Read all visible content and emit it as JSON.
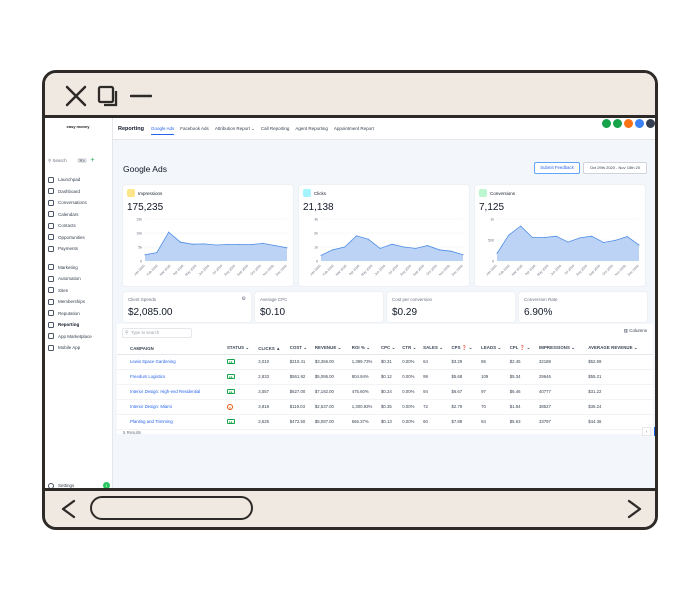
{
  "sidebar": {
    "logo": "easy money",
    "search_label": "Search",
    "search_shortcut": "⌘K",
    "items_group1": [
      {
        "label": "Launchpad",
        "icon": "rocket-icon"
      },
      {
        "label": "Dashboard",
        "icon": "dashboard-icon"
      },
      {
        "label": "Conversations",
        "icon": "chat-icon"
      },
      {
        "label": "Calendars",
        "icon": "calendar-icon"
      },
      {
        "label": "Contacts",
        "icon": "contacts-icon"
      },
      {
        "label": "Opportunities",
        "icon": "opportunities-icon"
      },
      {
        "label": "Payments",
        "icon": "payments-icon"
      }
    ],
    "items_group2": [
      {
        "label": "Marketing",
        "icon": "marketing-icon"
      },
      {
        "label": "Automation",
        "icon": "automation-icon"
      },
      {
        "label": "Sites",
        "icon": "sites-icon"
      },
      {
        "label": "Memberships",
        "icon": "memberships-icon"
      },
      {
        "label": "Reputation",
        "icon": "star-icon"
      },
      {
        "label": "Reporting",
        "icon": "reporting-icon",
        "active": true
      },
      {
        "label": "App Marketplace",
        "icon": "apps-icon"
      },
      {
        "label": "Mobile App",
        "icon": "mobile-icon"
      }
    ],
    "settings_label": "Settings",
    "settings_badge": "1"
  },
  "header": {
    "section": "Reporting",
    "tabs": [
      "Google Ads",
      "Facebook Ads",
      "Attribution Report ⌄",
      "Call Reporting",
      "Agent Reporting",
      "Appointment Report"
    ],
    "active_tab": "Google Ads",
    "icon_colors": [
      "#16a34a",
      "#16a34a",
      "#f97316",
      "#3b82f6",
      "#374151"
    ]
  },
  "page": {
    "title": "Google Ads",
    "feedback_button": "Submit Feedback",
    "date_range": "Oct 29th 2020 - Nov 15th 20"
  },
  "metrics": [
    {
      "label": "Impressions",
      "value": "175,235",
      "icon_color": "#fde68a",
      "y_ticks": [
        "15k",
        "10k",
        "5k",
        "0"
      ],
      "x_ticks": [
        "Jan 2020",
        "Feb 2020",
        "Mar 2020",
        "Apr 2020",
        "May 2020",
        "Jun 2020",
        "Jul 2020",
        "Aug 2020",
        "Sep 2020",
        "Oct 2020",
        "Nov 2020",
        "Dec 2020"
      ],
      "series": [
        2.2,
        3.0,
        10.3,
        6.7,
        6.0,
        6.1,
        5.7,
        5.9,
        5.9,
        5.9,
        6.3,
        5.5,
        4.7
      ]
    },
    {
      "label": "Clicks",
      "value": "21,138",
      "icon_color": "#a5f3fc",
      "y_ticks": [
        "3k",
        "2k",
        "1k",
        "0"
      ],
      "x_ticks": [
        "Jan 2020",
        "Feb 2020",
        "Mar 2020",
        "Apr 2020",
        "May 2020",
        "Jun 2020",
        "Jul 2020",
        "Aug 2020",
        "Sep 2020",
        "Oct 2020",
        "Nov 2020",
        "Dec 2020"
      ],
      "series": [
        0.4,
        0.8,
        1.0,
        1.8,
        1.55,
        0.9,
        1.2,
        1.0,
        0.9,
        1.1,
        0.8,
        0.7,
        0.45
      ]
    },
    {
      "label": "Conversions",
      "value": "7,125",
      "icon_color": "#bbf7d0",
      "y_ticks": [
        "1k",
        "500",
        "0"
      ],
      "x_ticks": [
        "Jan 2020",
        "Feb 2020",
        "Mar 2020",
        "Apr 2020",
        "May 2020",
        "Jun 2020",
        "Jul 2020",
        "Aug 2020",
        "Sep 2020",
        "Oct 2020",
        "Nov 2020",
        "Dec 2020"
      ],
      "series": [
        180,
        620,
        830,
        560,
        560,
        590,
        450,
        550,
        590,
        440,
        490,
        580,
        380
      ]
    }
  ],
  "stats": [
    {
      "label": "Client Spends",
      "value": "$2,085.00"
    },
    {
      "label": "Average CPC",
      "value": "$0.10"
    },
    {
      "label": "Cost per conversion",
      "value": "$0.29"
    },
    {
      "label": "Conversion Rate",
      "value": "6.90%"
    }
  ],
  "table": {
    "search_placeholder": "Type to search",
    "columns_button": "Columns",
    "headers": [
      "CAMPAIGN",
      "STATUS ⌄",
      "CLICKS ▲",
      "COST ⌄",
      "REVENUE ⌄",
      "ROI % ⌄",
      "CPC ⌄",
      "CTR ⌄",
      "SALES ⌄",
      "CPS ❓ ⌄",
      "LEADS ⌄",
      "CPL ❓ ⌄",
      "IMPRESSIONS ⌄",
      "AVERAGE REVENUE ⌄"
    ],
    "rows": [
      {
        "campaign": "Lewis Space Gardening",
        "status": "active",
        "clicks": "3,010",
        "cost": "$210.41",
        "revenue": "$3,366.00",
        "roi": "1,399.73%",
        "cpc": "$0.31",
        "ctr": "0.00%",
        "sales": "64",
        "cps": "$3.29",
        "leads": "86",
        "cpl": "$2.45",
        "impressions": "32188",
        "avg_revenue": "$52.59"
      },
      {
        "campaign": "Freedum Logistics",
        "status": "active",
        "clicks": "2,833",
        "cost": "$561.92",
        "revenue": "$5,086.00",
        "roi": "804.94%",
        "cpc": "$0.12",
        "ctr": "0.00%",
        "sales": "99",
        "cps": "$5.68",
        "leads": "109",
        "cpl": "$5.34",
        "impressions": "29646",
        "avg_revenue": "$55.21"
      },
      {
        "campaign": "Interior Design: High-end Residential",
        "status": "active",
        "clicks": "3,557",
        "cost": "$627.00",
        "revenue": "$7,182.00",
        "roi": "475.60%",
        "cpc": "$0.24",
        "ctr": "0.00%",
        "sales": "94",
        "cps": "$6.67",
        "leads": "97",
        "cpl": "$6.46",
        "impressions": "40777",
        "avg_revenue": "$31.22"
      },
      {
        "campaign": "Interior Design: Miami",
        "status": "paused",
        "clicks": "3,818",
        "cost": "$119.03",
        "revenue": "$2,537.00",
        "roi": "1,300.83%",
        "cpc": "$0.35",
        "ctr": "0.00%",
        "sales": "72",
        "cps": "$2.79",
        "leads": "70",
        "cpl": "$1.84",
        "impressions": "38527",
        "avg_revenue": "$36.24"
      },
      {
        "campaign": "Planting and Trimming",
        "status": "active",
        "clicks": "3,625",
        "cost": "$472.50",
        "revenue": "$5,087.00",
        "roi": "566.37%",
        "cpc": "$0.13",
        "ctr": "0.00%",
        "sales": "60",
        "cps": "$7.88",
        "leads": "84",
        "cpl": "$5.63",
        "impressions": "33797",
        "avg_revenue": "$44.36"
      }
    ],
    "results_text": "5 Results",
    "pagination": [
      "‹",
      "1",
      "›"
    ],
    "current_page": "1"
  }
}
